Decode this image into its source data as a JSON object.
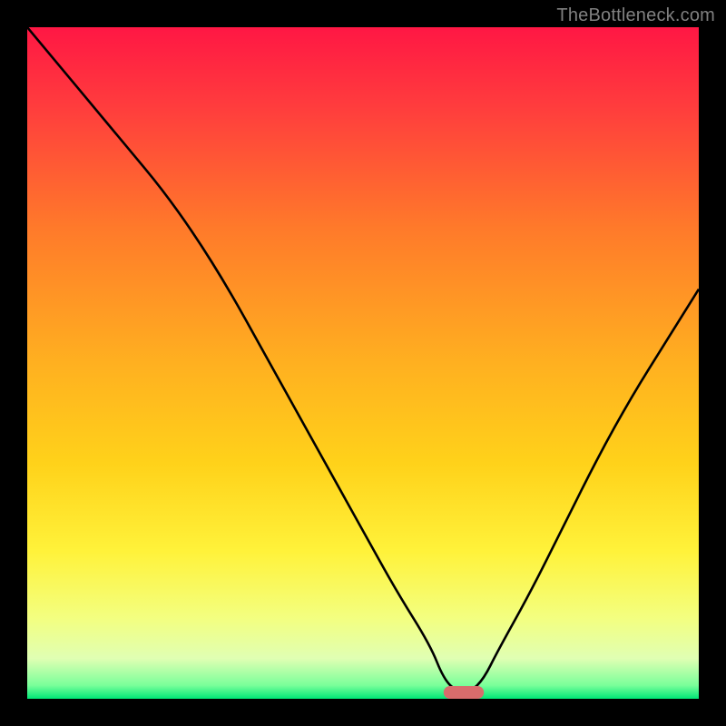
{
  "watermark": "TheBottleneck.com",
  "chart_data": {
    "type": "line",
    "title": "",
    "xlabel": "",
    "ylabel": "",
    "xlim": [
      0,
      100
    ],
    "ylim": [
      0,
      100
    ],
    "x": [
      0,
      5,
      10,
      15,
      20,
      25,
      30,
      35,
      40,
      45,
      50,
      55,
      60,
      62,
      64,
      66,
      68,
      70,
      75,
      80,
      85,
      90,
      95,
      100
    ],
    "values": [
      100,
      94,
      88,
      82,
      76,
      69,
      61,
      52,
      43,
      34,
      25,
      16,
      8,
      3,
      1,
      1,
      3,
      7,
      16,
      26,
      36,
      45,
      53,
      61
    ],
    "notch": {
      "x": 65,
      "width": 3,
      "color": "#d86c6c"
    },
    "gradient_stops": [
      {
        "offset": 0.0,
        "color": "#ff1744"
      },
      {
        "offset": 0.12,
        "color": "#ff3d3d"
      },
      {
        "offset": 0.3,
        "color": "#ff7a2a"
      },
      {
        "offset": 0.5,
        "color": "#ffb020"
      },
      {
        "offset": 0.65,
        "color": "#ffd21a"
      },
      {
        "offset": 0.78,
        "color": "#fff23a"
      },
      {
        "offset": 0.88,
        "color": "#f3ff80"
      },
      {
        "offset": 0.94,
        "color": "#e0ffb3"
      },
      {
        "offset": 0.98,
        "color": "#7aff9a"
      },
      {
        "offset": 1.0,
        "color": "#00e676"
      }
    ]
  }
}
